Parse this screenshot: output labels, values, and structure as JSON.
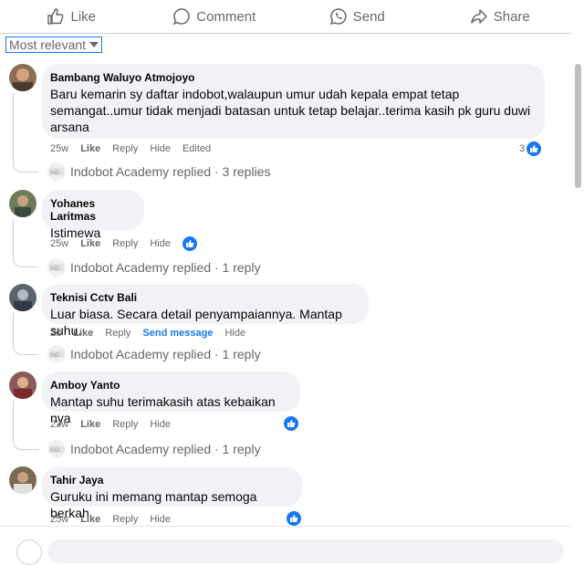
{
  "actions": {
    "like": "Like",
    "comment": "Comment",
    "send": "Send",
    "share": "Share"
  },
  "sort_label": "Most relevant",
  "comments": [
    {
      "author": "Bambang Waluyo Atmojoyo",
      "lines": [
        "Baru kemarin sy daftar indobot,walaupun umur udah kepala empat tetap",
        "semangat..umur tidak menjadi batasan untuk tetap belajar..terima kasih pk guru duwi",
        "arsana"
      ],
      "time": "25w",
      "like": "Like",
      "reply": "Reply",
      "hide": "Hide",
      "edited": "Edited",
      "reactions": "3",
      "replies": "Indobot Academy replied · 3 replies"
    },
    {
      "author": "Yohanes Laritmas",
      "lines": [
        "Istimewa"
      ],
      "time": "25w",
      "like": "Like",
      "reply": "Reply",
      "hide": "Hide",
      "replies": "Indobot Academy replied · 1 reply"
    },
    {
      "author": "Teknisi Cctv Bali",
      "lines": [
        "Luar biasa. Secara detail penyampaiannya. Mantap suhu."
      ],
      "time": "2d",
      "like": "Like",
      "reply": "Reply",
      "send": "Send message",
      "hide": "Hide",
      "replies": "Indobot Academy replied · 1 reply"
    },
    {
      "author": "Amboy Yanto",
      "lines": [
        "Mantap suhu terimakasih atas kebaikan nya"
      ],
      "time": "23w",
      "like": "Like",
      "reply": "Reply",
      "hide": "Hide",
      "replies": "Indobot Academy replied · 1 reply"
    },
    {
      "author": "Tahir Jaya",
      "lines": [
        "Guruku ini memang mantap semoga berkah"
      ],
      "time": "25w",
      "like": "Like",
      "reply": "Reply",
      "hide": "Hide"
    }
  ],
  "colors": {
    "accent": "#1877f2",
    "muted": "#65676b",
    "bubble": "#f0f2f5"
  }
}
